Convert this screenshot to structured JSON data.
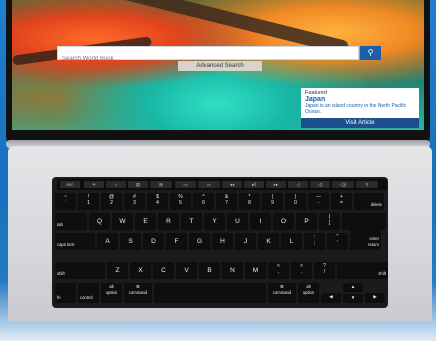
{
  "website": {
    "search_placeholder": "Search World Book",
    "search_button_icon": "search-icon",
    "advanced_search_label": "Advanced Search",
    "featured": {
      "label": "Featured",
      "title": "Japan",
      "description": "Japan is an island country in the North Pacific Ocean."
    },
    "visit_article_label": "Visit Article",
    "colors": {
      "brand_blue": "#1c5ea8",
      "dark_blue": "#1c4f8e"
    }
  },
  "touchbar": [
    "esc",
    "☀",
    "☼",
    "▤",
    "⊞",
    "▭",
    "▭",
    "◂◂",
    "▸‖",
    "▸▸",
    "◁",
    "◁)",
    "◁))",
    "⚲"
  ],
  "keyboard": {
    "row1": [
      {
        "top": "~",
        "bot": "`"
      },
      {
        "top": "!",
        "bot": "1"
      },
      {
        "top": "@",
        "bot": "2"
      },
      {
        "top": "#",
        "bot": "3"
      },
      {
        "top": "$",
        "bot": "4"
      },
      {
        "top": "%",
        "bot": "5"
      },
      {
        "top": "^",
        "bot": "6"
      },
      {
        "top": "&",
        "bot": "7"
      },
      {
        "top": "*",
        "bot": "8"
      },
      {
        "top": "(",
        "bot": "9"
      },
      {
        "top": ")",
        "bot": "0"
      },
      {
        "top": "—",
        "bot": "-"
      },
      {
        "top": "+",
        "bot": "="
      }
    ],
    "delete": "delete",
    "tab": "tab",
    "row2": [
      "Q",
      "W",
      "E",
      "R",
      "T",
      "Y",
      "U",
      "I",
      "O",
      "P"
    ],
    "row2_sym": [
      {
        "top": "{",
        "bot": "["
      },
      {
        "top": "}",
        "bot": "]"
      },
      {
        "top": "|",
        "bot": "\\"
      }
    ],
    "caps": "caps lock",
    "row3": [
      "A",
      "S",
      "D",
      "F",
      "G",
      "H",
      "J",
      "K",
      "L"
    ],
    "row3_sym": [
      {
        "top": ":",
        "bot": ";"
      },
      {
        "top": "\"",
        "bot": "'"
      }
    ],
    "enter": "enter",
    "return": "return",
    "shift_left": "shift",
    "row4": [
      "Z",
      "X",
      "C",
      "V",
      "B",
      "N",
      "M"
    ],
    "row4_sym": [
      {
        "top": "<",
        "bot": ","
      },
      {
        "top": ">",
        "bot": "."
      },
      {
        "top": "?",
        "bot": "/"
      }
    ],
    "shift_right": "shift",
    "fn": "fn",
    "control": "control",
    "option_left": "option",
    "option_left_sym": "alt",
    "command_left": "command",
    "command_left_sym": "⌘",
    "command_right": "command",
    "command_right_sym": "⌘",
    "option_right": "option",
    "option_right_sym": "alt",
    "arrows": [
      "◀",
      "▲",
      "▼",
      "▶"
    ]
  }
}
